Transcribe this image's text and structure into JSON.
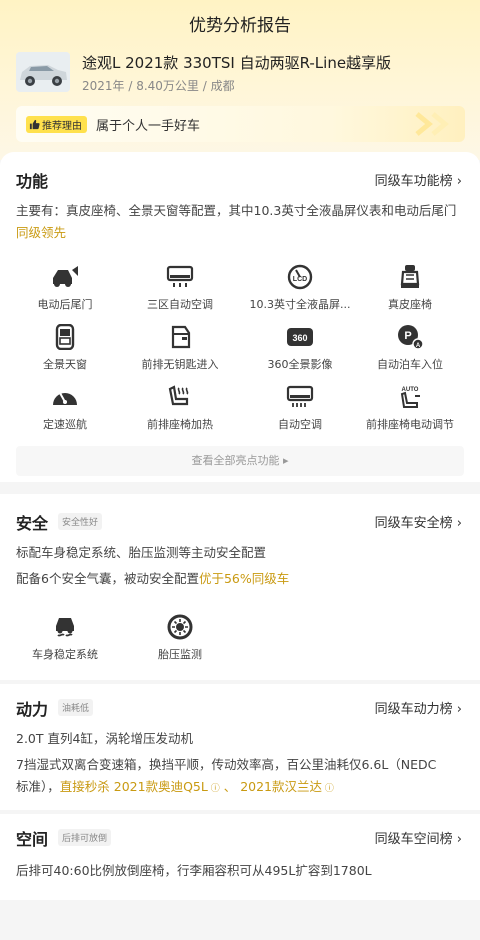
{
  "page": {
    "title": "优势分析报告"
  },
  "car": {
    "name": "途观L 2021款 330TSI 自动两驱R-Line越享版",
    "meta": "2021年 / 8.40万公里 / 成都"
  },
  "reason": {
    "badge": "推荐理由",
    "text": "属于个人一手好车"
  },
  "function": {
    "title": "功能",
    "link": "同级车功能榜",
    "desc_main": "主要有：真皮座椅、全景天窗等配置，其中10.3英寸全液晶屏仪表和电动后尾门",
    "desc_highlight": "同级领先",
    "items": [
      {
        "label": "电动后尾门",
        "icon": "power-tailgate-icon"
      },
      {
        "label": "三区自动空调",
        "icon": "climate-zone-icon"
      },
      {
        "label": "10.3英寸全液晶屏...",
        "icon": "lcd-cluster-icon"
      },
      {
        "label": "真皮座椅",
        "icon": "leather-seat-icon"
      },
      {
        "label": "全景天窗",
        "icon": "sunroof-icon"
      },
      {
        "label": "前排无钥匙进入",
        "icon": "keyless-entry-icon"
      },
      {
        "label": "360全景影像",
        "icon": "camera-360-icon"
      },
      {
        "label": "自动泊车入位",
        "icon": "auto-park-icon"
      },
      {
        "label": "定速巡航",
        "icon": "cruise-control-icon"
      },
      {
        "label": "前排座椅加热",
        "icon": "seat-heating-icon"
      },
      {
        "label": "自动空调",
        "icon": "auto-ac-icon"
      },
      {
        "label": "前排座椅电动调节",
        "icon": "power-seat-icon"
      }
    ],
    "more": "查看全部亮点功能"
  },
  "safety": {
    "title": "安全",
    "tag": "安全性好",
    "link": "同级车安全榜",
    "line1": "标配车身稳定系统、胎压监测等主动安全配置",
    "line2_main": "配备6个安全气囊，被动安全配置",
    "line2_highlight": "优于56%同级车",
    "items": [
      {
        "label": "车身稳定系统",
        "icon": "stability-control-icon"
      },
      {
        "label": "胎压监测",
        "icon": "tire-pressure-icon"
      }
    ]
  },
  "power": {
    "title": "动力",
    "tag": "油耗低",
    "link": "同级车动力榜",
    "line1": "2.0T 直列4缸，涡轮增压发动机",
    "line2": "7挡湿式双离合变速箱，换挡平顺，传动效率高，百公里油耗仅6.6L（NEDC",
    "line3_prefix": "标准），",
    "compare_lead": "直接秒杀",
    "compare1": "2021款奥迪Q5L",
    "separator": "、",
    "compare2": "2021款汉兰达"
  },
  "space": {
    "title": "空间",
    "tag": "后排可放倒",
    "link": "同级车空间榜",
    "line1": "后排可40:60比例放倒座椅，行李厢容积可从495L扩容到1780L"
  }
}
